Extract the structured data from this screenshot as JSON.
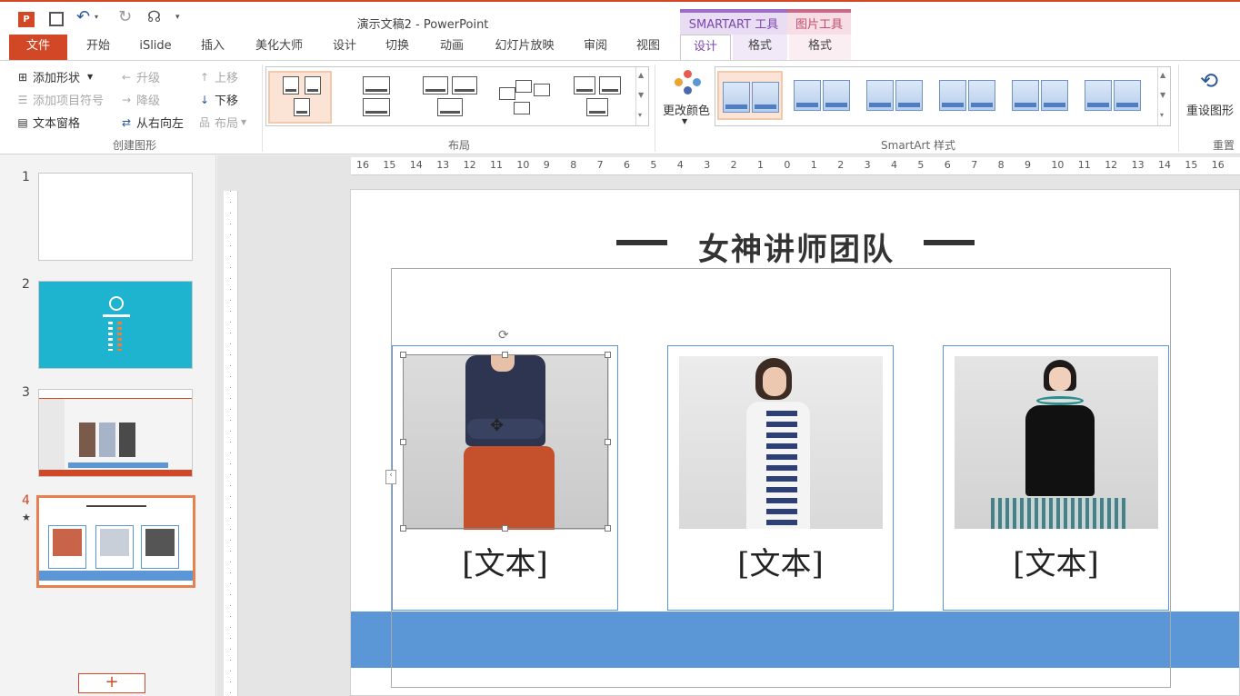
{
  "app": {
    "window_title": "演示文稿2 - PowerPoint"
  },
  "contextual_tabs": {
    "smartart_tools": "SMARTART 工具",
    "picture_tools": "图片工具"
  },
  "tabs": [
    "文件",
    "开始",
    "iSlide",
    "插入",
    "美化大师",
    "设计",
    "切换",
    "动画",
    "幻灯片放映",
    "审阅",
    "视图",
    "设计",
    "格式",
    "格式"
  ],
  "ribbon": {
    "create_graphic": {
      "label": "创建图形",
      "add_shape": "添加形状",
      "add_bullet": "添加项目符号",
      "text_pane": "文本窗格",
      "promote": "升级",
      "demote": "降级",
      "right_to_left": "从右向左",
      "move_up": "上移",
      "move_down": "下移",
      "layout_btn": "布局"
    },
    "layouts": {
      "label": "布局"
    },
    "smartart_styles": {
      "label": "SmartArt 样式",
      "change_colors": "更改颜色"
    },
    "reset": {
      "reset_graphic": "重设图形",
      "label": "重置"
    }
  },
  "ruler": {
    "horizontal": [
      "16",
      "15",
      "14",
      "13",
      "12",
      "11",
      "10",
      "9",
      "8",
      "7",
      "6",
      "5",
      "4",
      "3",
      "2",
      "1",
      "0",
      "1",
      "2",
      "3",
      "4",
      "5",
      "6",
      "7",
      "8",
      "9",
      "10",
      "11",
      "12",
      "13",
      "14",
      "15",
      "16"
    ]
  },
  "thumbnails": [
    {
      "number": "1"
    },
    {
      "number": "2"
    },
    {
      "number": "3"
    },
    {
      "number": "4",
      "marker": "★"
    }
  ],
  "new_slide": "+",
  "slide": {
    "title": "女神讲师团队",
    "cards": [
      {
        "text": "[文本]"
      },
      {
        "text": "[文本]"
      },
      {
        "text": "[文本]"
      }
    ]
  },
  "colors": {
    "accent": "#d24726",
    "smartart_blue": "#5b96d7",
    "context_purple": "#7b47b0"
  }
}
